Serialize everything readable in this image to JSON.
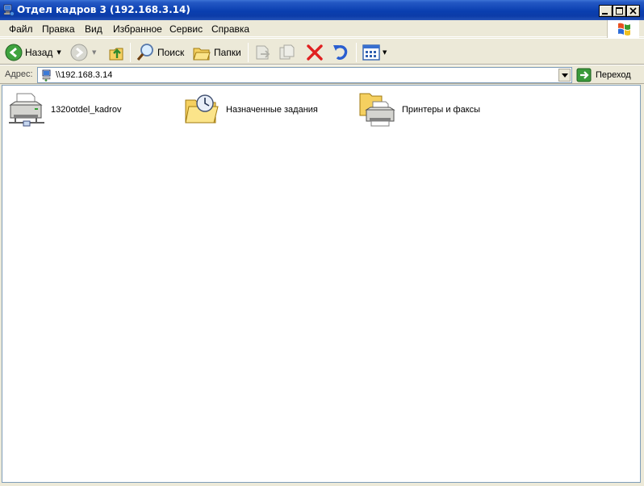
{
  "window": {
    "title": "Отдел кадров 3 (192.168.3.14)"
  },
  "menu": {
    "items": [
      "Файл",
      "Правка",
      "Вид",
      "Избранное",
      "Сервис",
      "Справка"
    ]
  },
  "toolbar": {
    "back_label": "Назад",
    "search_label": "Поиск",
    "folders_label": "Папки"
  },
  "address": {
    "label": "Адрес:",
    "value": "\\\\192.168.3.14",
    "go_label": "Переход"
  },
  "items": [
    {
      "label": "1320otdel_kadrov",
      "icon": "network-printer-icon"
    },
    {
      "label": "Назначенные задания",
      "icon": "scheduled-tasks-folder-icon"
    },
    {
      "label": "Принтеры и факсы",
      "icon": "printers-faxes-folder-icon"
    }
  ],
  "colors": {
    "title_bar": "#0a3fb0",
    "chrome": "#ece9d8",
    "close_x": "#e02020",
    "go_green": "#3a9a3a"
  }
}
